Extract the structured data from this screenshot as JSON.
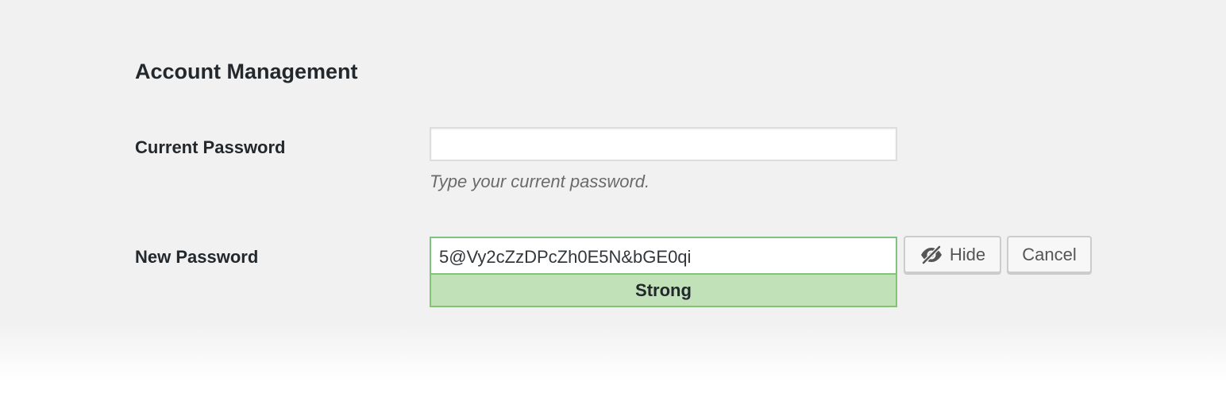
{
  "section": {
    "title": "Account Management"
  },
  "current_password": {
    "label": "Current Password",
    "value": "",
    "help": "Type your current password."
  },
  "new_password": {
    "label": "New Password",
    "value": "5@Vy2cZzDPcZh0E5N&bGE0qi",
    "strength": "Strong",
    "strength_color": "#c1e1b9"
  },
  "buttons": {
    "hide_label": "Hide",
    "hide_icon": "eye-slash-icon",
    "cancel_label": "Cancel"
  }
}
